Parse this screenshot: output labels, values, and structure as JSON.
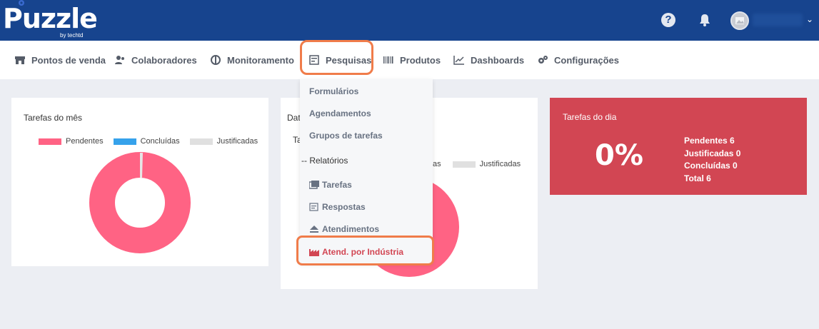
{
  "header": {
    "logo_text": "Puzzle",
    "logo_sub": "by techtd",
    "help_symbol": "?",
    "user_caret": "⌄"
  },
  "nav": [
    {
      "label": "Pontos de venda",
      "icon": "store-icon"
    },
    {
      "label": "Colaboradores",
      "icon": "users-icon"
    },
    {
      "label": "Monitoramento",
      "icon": "tent-icon"
    },
    {
      "label": "Pesquisas",
      "icon": "form-icon"
    },
    {
      "label": "Produtos",
      "icon": "barcode-icon"
    },
    {
      "label": "Dashboards",
      "icon": "chart-line-icon"
    },
    {
      "label": "Configurações",
      "icon": "gears-icon"
    }
  ],
  "card_month": {
    "title": "Tarefas do mês",
    "legend": [
      {
        "label": "Pendentes",
        "color": "#ff6384"
      },
      {
        "label": "Concluídas",
        "color": "#36a2eb"
      },
      {
        "label": "Justificadas",
        "color": "#e0e0e0"
      }
    ]
  },
  "card_mid": {
    "title_fragment": "Dat",
    "sub_fragment": "Ta",
    "legend_fragment": "as",
    "legend_label": "Justificadas"
  },
  "card_day": {
    "title": "Tarefas do dia",
    "percent": "0%",
    "stats": [
      "Pendentes 6",
      "Justificadas 0",
      "Concluídas 0",
      "Total 6"
    ]
  },
  "dropdown": {
    "items": [
      "Formulários",
      "Agendamentos",
      "Grupos de tarefas"
    ],
    "section": "-- Relatórios",
    "sub_items": [
      "Tarefas",
      "Respostas",
      "Atendimentos",
      "Atend. por Indústria"
    ]
  },
  "colors": {
    "header": "#17448e",
    "pink": "#ff6384",
    "red_card": "#d24653",
    "highlight": "#f07c4a"
  }
}
